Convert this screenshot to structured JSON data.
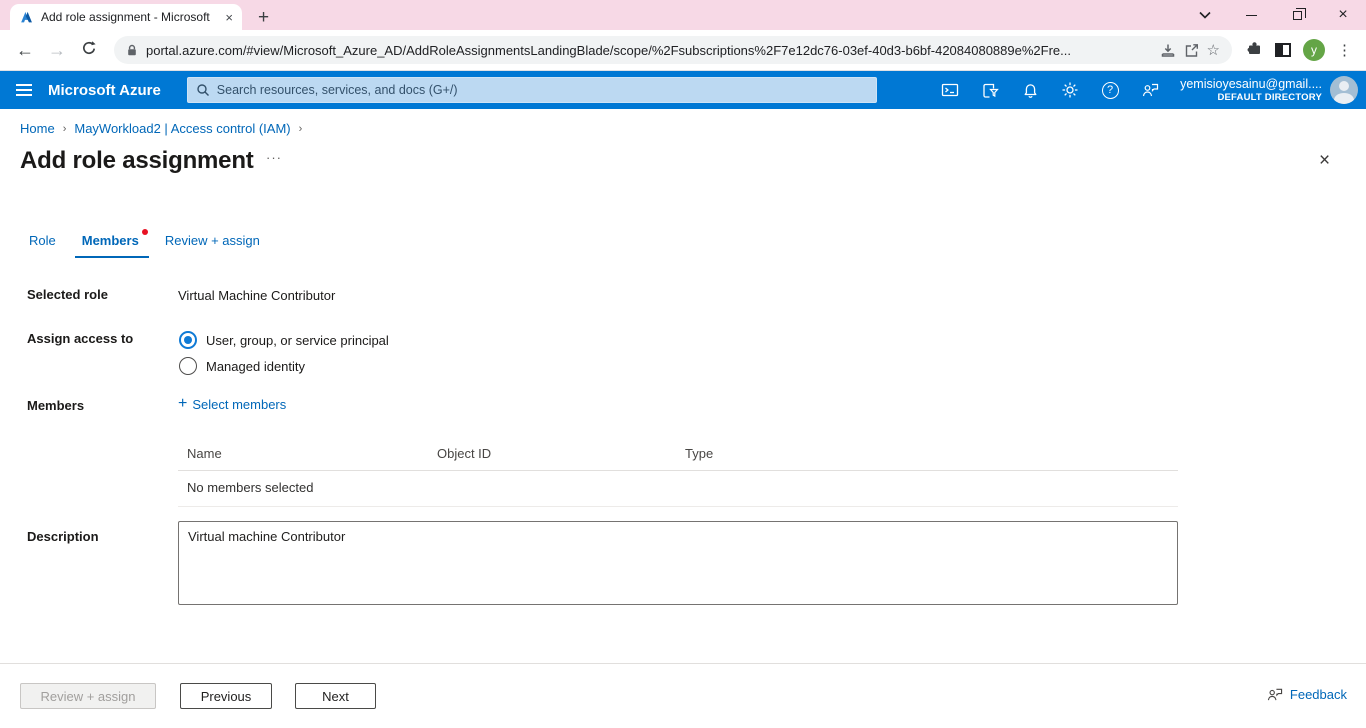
{
  "colors": {
    "azure_blue": "#0078d4",
    "link_blue": "#0067b8",
    "tabstrip_pink": "#f7d9e6",
    "alert_red": "#e81123",
    "avatar_green": "#64a546"
  },
  "icons": {
    "tab_close": "×",
    "new_tab": "+",
    "back": "←",
    "forward": "→",
    "star": "☆",
    "more_vert": "⋮",
    "overflow_dots": "···",
    "blade_close": "×",
    "help": "?",
    "plus": "+"
  },
  "browser": {
    "tab_title": "Add role assignment - Microsoft",
    "url": "portal.azure.com/#view/Microsoft_Azure_AD/AddRoleAssignmentsLandingBlade/scope/%2Fsubscriptions%2F7e12dc76-03ef-40d3-b6bf-42084080889e%2Fre...",
    "profile_initial": "y"
  },
  "topbar": {
    "brand": "Microsoft Azure",
    "search_placeholder": "Search resources, services, and docs (G+/)",
    "email": "yemisioyesainu@gmail....",
    "directory": "DEFAULT DIRECTORY"
  },
  "breadcrumb": {
    "home": "Home",
    "parent": "MayWorkload2 | Access control (IAM)",
    "sep": "›"
  },
  "page": {
    "title": "Add role assignment"
  },
  "tabs": {
    "role": "Role",
    "members": "Members",
    "review": "Review + assign"
  },
  "form": {
    "selected_role_label": "Selected role",
    "selected_role_value": "Virtual Machine Contributor",
    "assign_label": "Assign access to",
    "option_user": "User, group, or service principal",
    "option_managed": "Managed identity",
    "members_label": "Members",
    "select_members": "Select members",
    "table": {
      "col_name": "Name",
      "col_object_id": "Object ID",
      "col_type": "Type",
      "empty": "No members selected"
    },
    "description_label": "Description",
    "description_value": "Virtual machine Contributor"
  },
  "footer": {
    "review_assign": "Review + assign",
    "previous": "Previous",
    "next": "Next",
    "feedback": "Feedback"
  }
}
